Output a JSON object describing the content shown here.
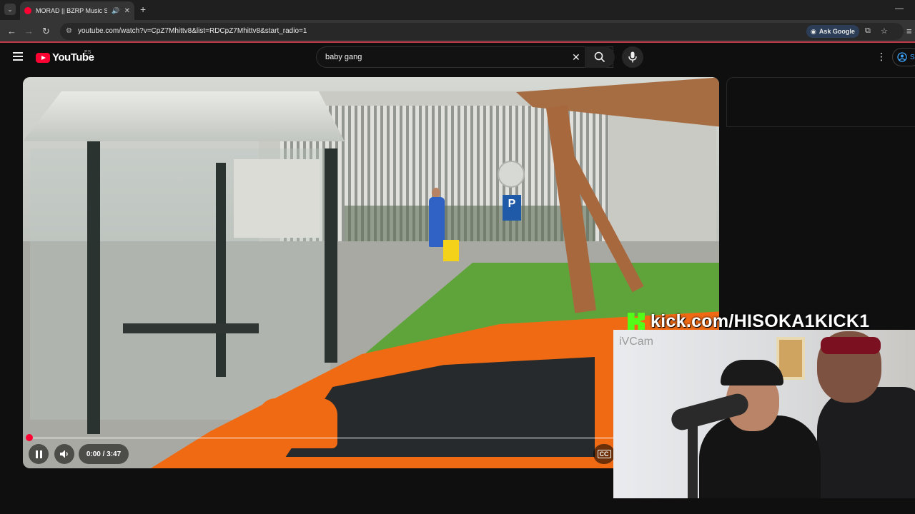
{
  "browser": {
    "tab_title": "MORAD || BZRP Music Sessions",
    "url": "youtube.com/watch?v=CpZ7Mhittv8&list=RDCpZ7Mhittv8&start_radio=1",
    "ask_google": "Ask Google"
  },
  "youtube": {
    "logo_text": "YouTube",
    "country_code": "ES",
    "search_value": "baby gang",
    "signin_partial": "S"
  },
  "player": {
    "time": "0:00 / 3:47",
    "progress_fraction": 0.0,
    "cc_label": "CC"
  },
  "overlay": {
    "kick_url": "kick.com/HISOKA1KICK1",
    "cam_label": "iVCam"
  },
  "colors": {
    "yt_red": "#ff0033",
    "kick_green": "#53fc18",
    "background": "#0f0f0f"
  }
}
